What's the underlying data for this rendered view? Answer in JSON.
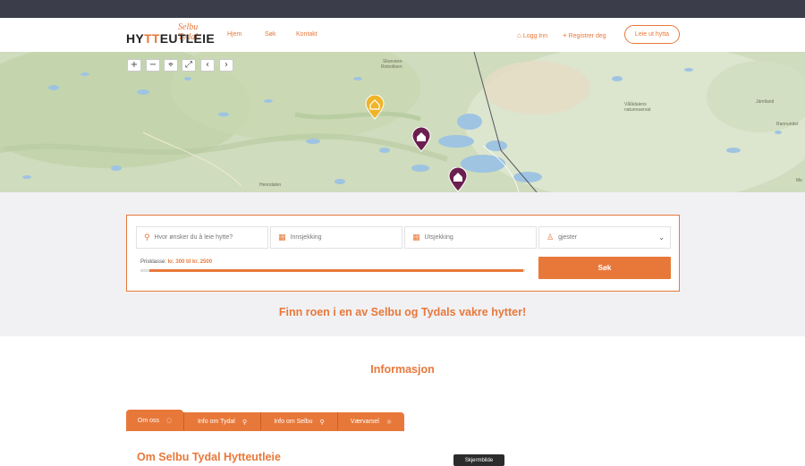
{
  "brand": {
    "logo_main_a": "HY",
    "logo_main_tt": "TT",
    "logo_main_b": "EUTLEIE",
    "logo_sub": "Selbu Tydal",
    "accent_color": "#e8783a"
  },
  "nav": {
    "home": "Hjem",
    "search": "Søk",
    "contact": "Kontakt",
    "login": "Logg Inn",
    "register": "Registrer deg",
    "rent_out": "Leie ut hytta"
  },
  "map": {
    "controls": [
      "+",
      "−",
      "pin",
      "fullscreen",
      "<",
      ">"
    ],
    "labels": [
      "Skarvane-Rotvoltsen",
      "Skalmen",
      "Ramsjøen",
      "Henndalen",
      "Sylane",
      "Vålådalens naturreservat",
      "Jämtland",
      "Rannundet",
      "Me"
    ],
    "markers": [
      {
        "type": "yellow-cabin-marker"
      },
      {
        "type": "purple-cabin-marker"
      },
      {
        "type": "purple-cabin-marker"
      }
    ]
  },
  "search": {
    "where_placeholder": "Hvor ønsker du å leie hytte?",
    "checkin_placeholder": "Innsjekking",
    "checkout_placeholder": "Utsjekking",
    "guests_placeholder": "gjester",
    "price_label": "Prisklasse:",
    "price_value": "kr. 300 til kr. 2500",
    "price_range_fraction": 1.0,
    "button": "Søk"
  },
  "tagline": "Finn roen i en av Selbu og Tydals vakre hytter!",
  "info": {
    "title": "Informasjon",
    "tabs": [
      {
        "label": "Om oss",
        "icon": "chat-icon"
      },
      {
        "label": "Info om Tydal",
        "icon": "pin-icon"
      },
      {
        "label": "Info om Selbu",
        "icon": "pin-icon"
      },
      {
        "label": "Værvarsel",
        "icon": "sun-icon"
      }
    ],
    "section_heading": "Om Selbu Tydal Hytteutleie"
  },
  "overlay": {
    "screenshot_label": "Skjermbilde"
  }
}
